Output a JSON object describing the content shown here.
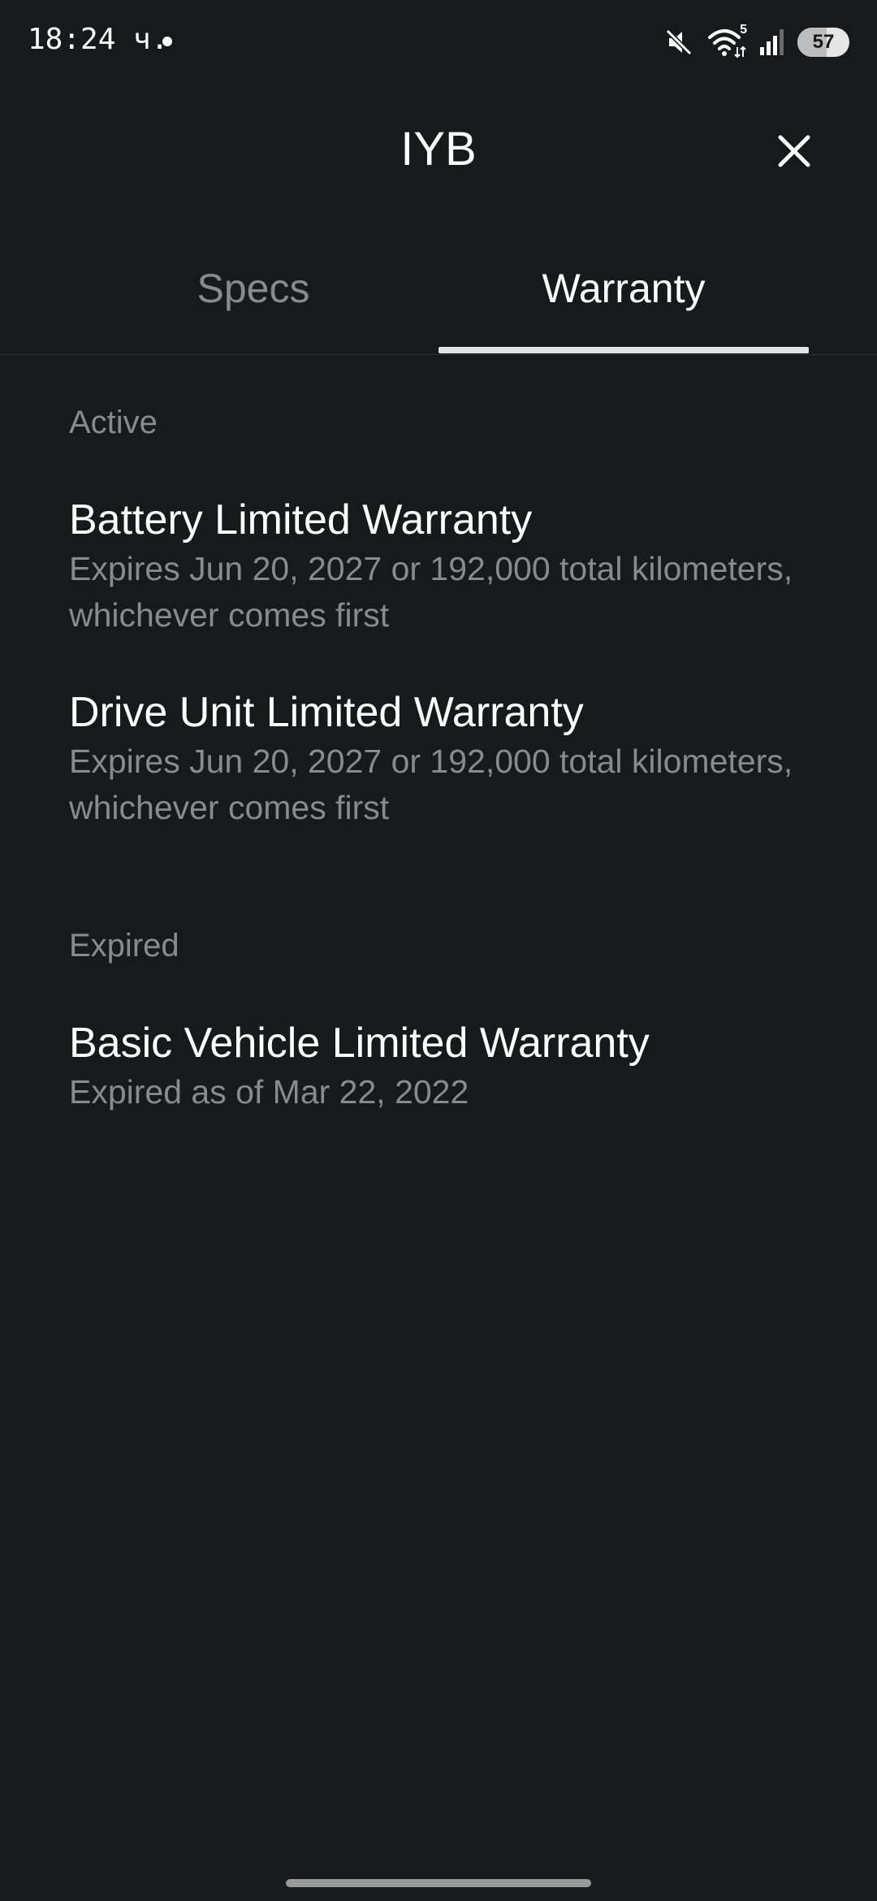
{
  "status_bar": {
    "time": "18:24 ч.",
    "wifi_label": "5",
    "battery_level": "57",
    "icons": [
      "mute-icon",
      "wifi-icon",
      "signal-icon",
      "battery-icon"
    ]
  },
  "header": {
    "title": "IYB",
    "close_icon": "close-icon"
  },
  "tabs": [
    {
      "label": "Specs",
      "active": false
    },
    {
      "label": "Warranty",
      "active": true
    }
  ],
  "sections": {
    "active": {
      "heading": "Active",
      "items": [
        {
          "title": "Battery Limited Warranty",
          "description": "Expires Jun 20, 2027 or 192,000 total kilometers, whichever comes first"
        },
        {
          "title": "Drive Unit Limited Warranty",
          "description": "Expires Jun 20, 2027 or 192,000 total kilometers, whichever comes first"
        }
      ]
    },
    "expired": {
      "heading": "Expired",
      "items": [
        {
          "title": "Basic Vehicle Limited Warranty",
          "description": "Expired as of Mar 22, 2022"
        }
      ]
    }
  },
  "colors": {
    "background": "#18191b",
    "primary_text": "#ffffff",
    "secondary_text": "#8a8a8c",
    "tab_indicator": "#e4e4e4"
  }
}
